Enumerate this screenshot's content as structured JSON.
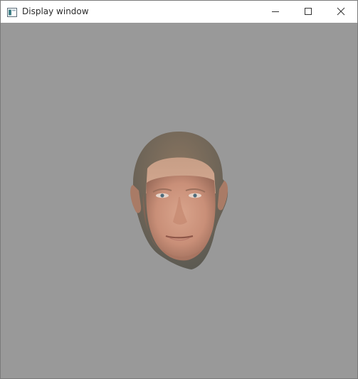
{
  "window": {
    "title": "Display window",
    "icon": "app-window-icon",
    "controls": {
      "minimize": "minimize-icon",
      "maximize": "maximize-icon",
      "close": "close-icon"
    }
  },
  "viewport": {
    "background_color": "#999999",
    "content": "rendered-3d-face-mesh"
  }
}
